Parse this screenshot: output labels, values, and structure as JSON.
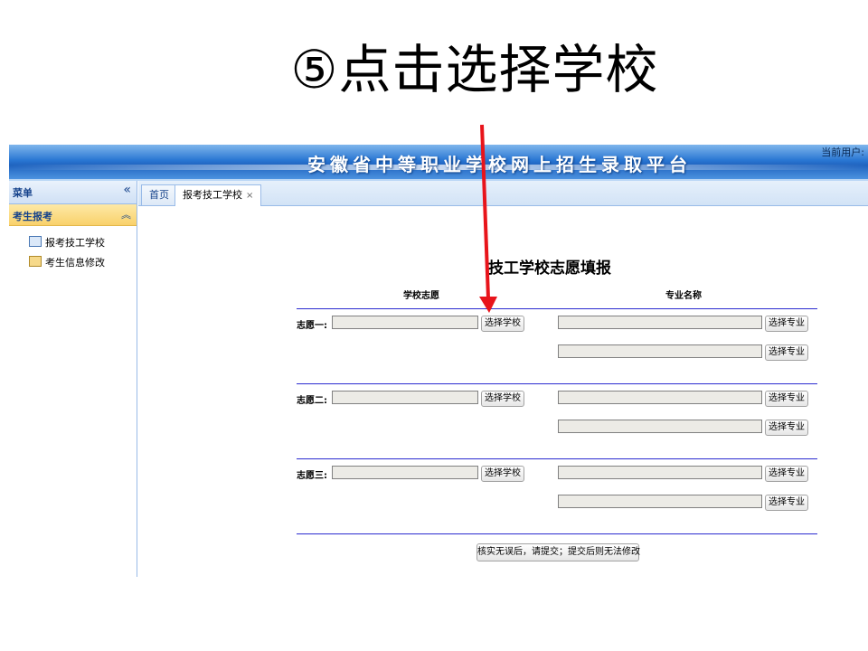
{
  "slide_title": "⑤点击选择学校",
  "app": {
    "banner_title": "安徽省中等职业学校网上招生录取平台",
    "current_user_label": "当前用户:"
  },
  "sidebar": {
    "header": "菜单",
    "collapse_glyph": "«",
    "section": "考生报考",
    "expand_glyph": "︽",
    "items": [
      {
        "label": "报考技工学校"
      },
      {
        "label": "考生信息修改"
      }
    ]
  },
  "tabs": [
    {
      "label": "首页"
    },
    {
      "label": "报考技工学校",
      "close": "×"
    }
  ],
  "form": {
    "title": "技工学校志愿填报",
    "col_school": "学校志愿",
    "col_major": "专业名称",
    "wishes": [
      {
        "label": "志愿一:",
        "school_value": "",
        "choose_school": "选择学校",
        "majors": [
          {
            "value": "",
            "choose_major": "选择专业"
          },
          {
            "value": "",
            "choose_major": "选择专业"
          }
        ]
      },
      {
        "label": "志愿二:",
        "school_value": "",
        "choose_school": "选择学校",
        "majors": [
          {
            "value": "",
            "choose_major": "选择专业"
          },
          {
            "value": "",
            "choose_major": "选择专业"
          }
        ]
      },
      {
        "label": "志愿三:",
        "school_value": "",
        "choose_school": "选择学校",
        "majors": [
          {
            "value": "",
            "choose_major": "选择专业"
          },
          {
            "value": "",
            "choose_major": "选择专业"
          }
        ]
      }
    ],
    "submit_label": "核实无误后，请提交；提交后则无法修改"
  },
  "colors": {
    "arrow": "#e8141b",
    "divider": "#2b2bd0",
    "banner": "#2a77d3"
  }
}
